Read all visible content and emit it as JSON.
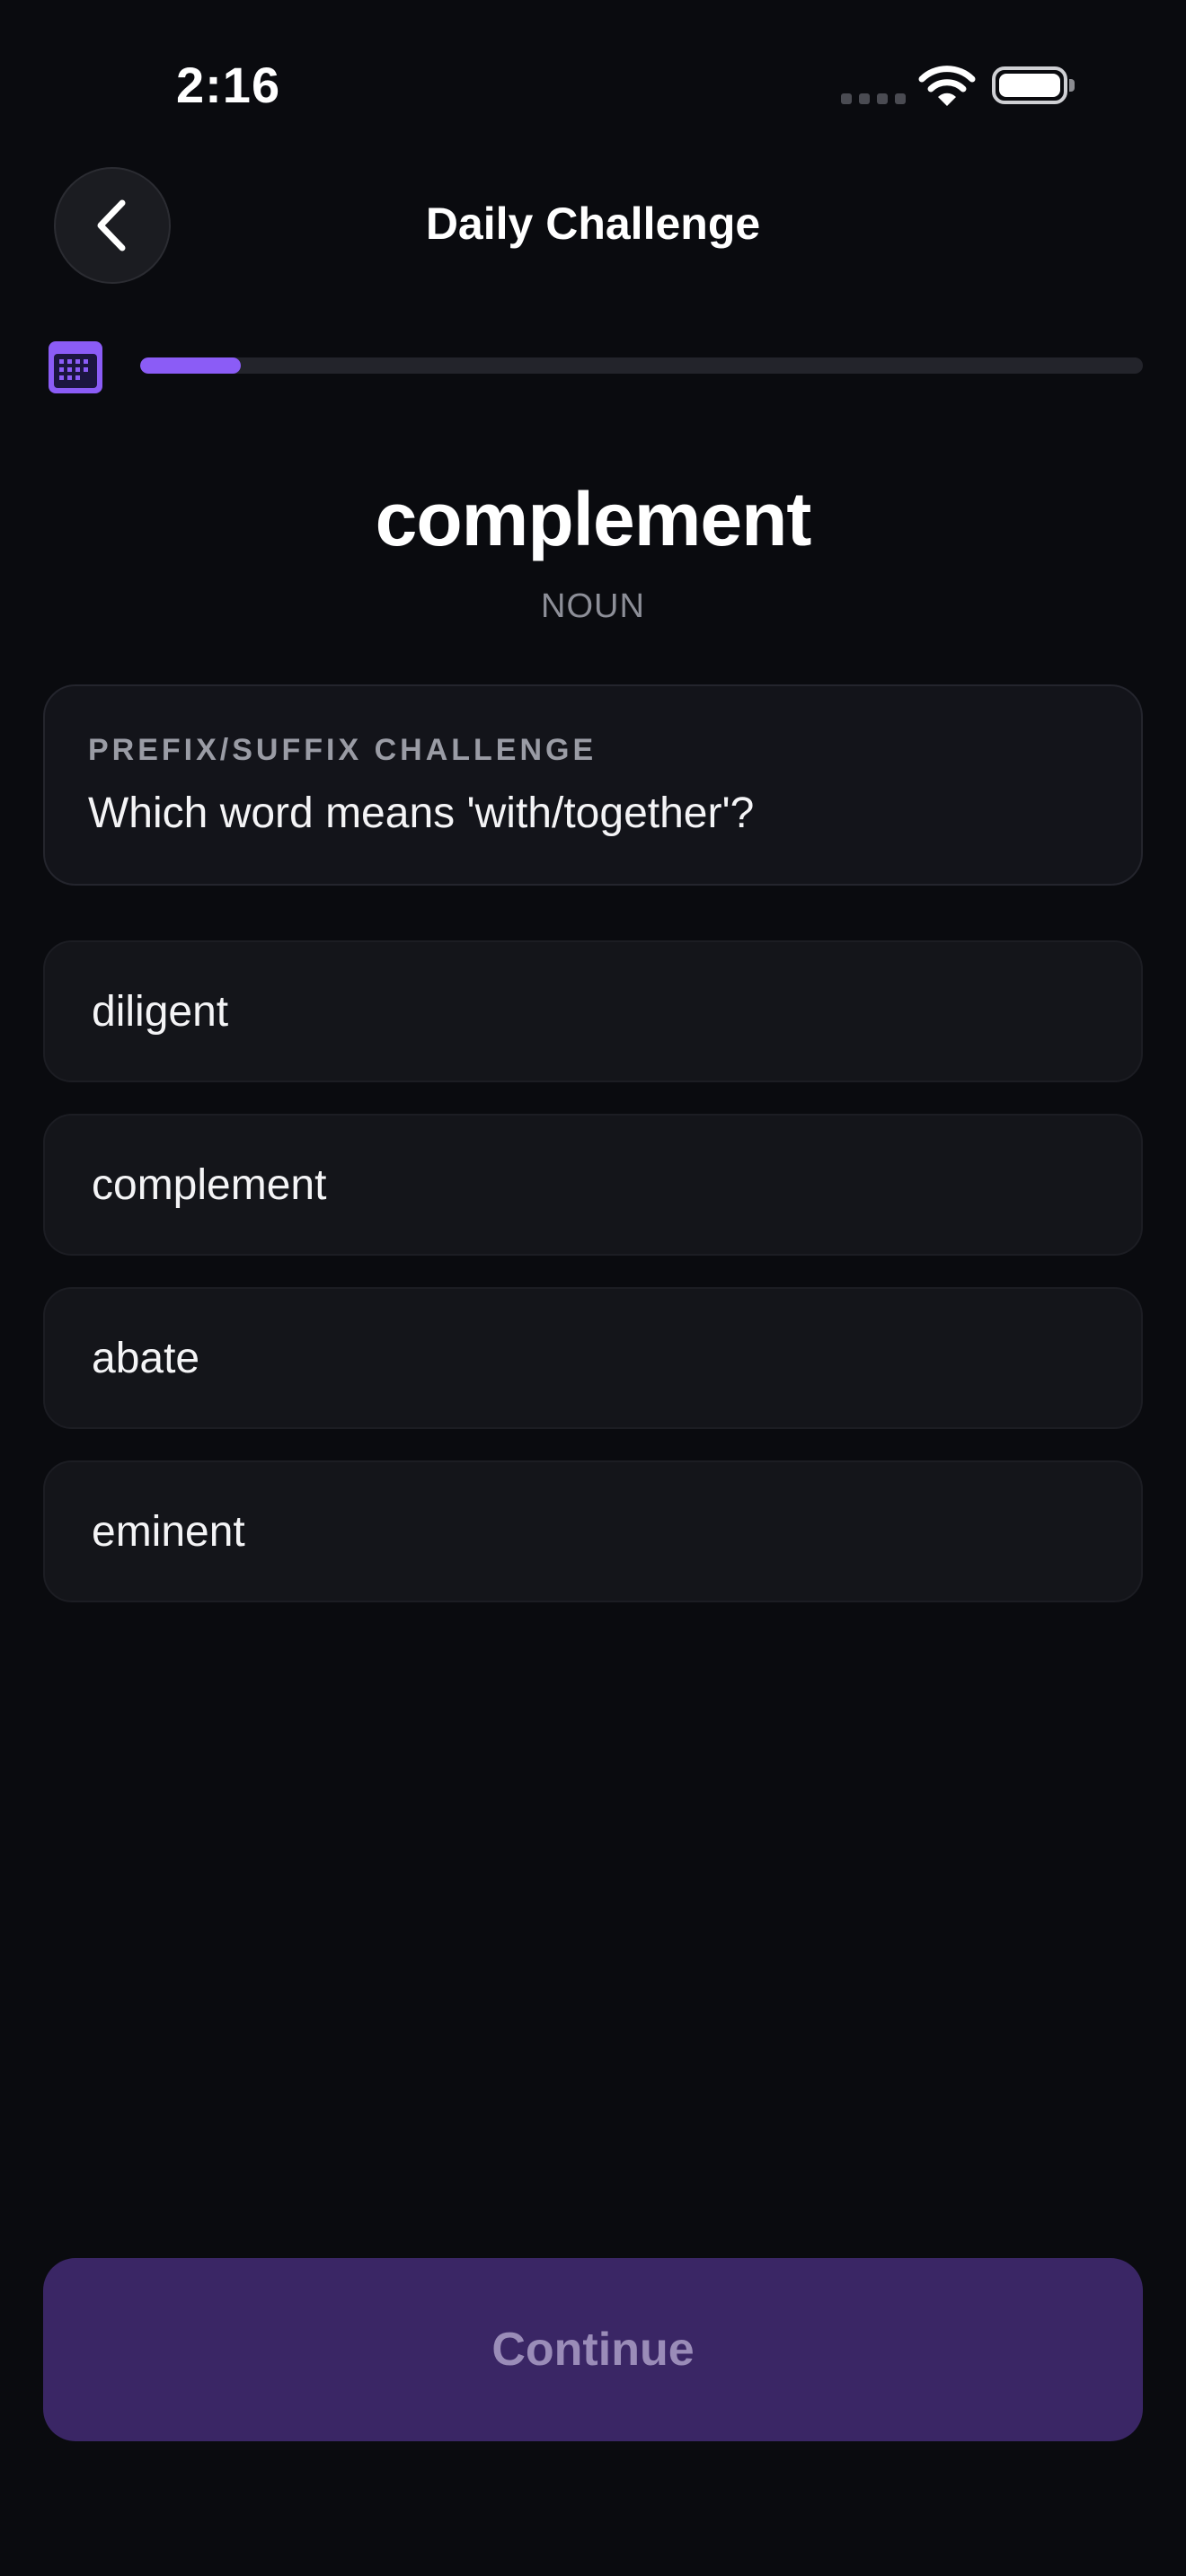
{
  "status_bar": {
    "time": "2:16"
  },
  "header": {
    "title": "Daily Challenge",
    "back_icon": "chevron-left-icon"
  },
  "progress": {
    "icon": "calendar-icon",
    "fraction": 0.1,
    "accent_color": "#8b5cf6"
  },
  "word": {
    "text": "complement",
    "part_of_speech": "NOUN"
  },
  "question": {
    "label": "PREFIX/SUFFIX CHALLENGE",
    "text": "Which word means 'with/together'?"
  },
  "options": [
    {
      "label": "diligent"
    },
    {
      "label": "complement"
    },
    {
      "label": "abate"
    },
    {
      "label": "eminent"
    }
  ],
  "continue_button": {
    "label": "Continue",
    "enabled": false
  }
}
